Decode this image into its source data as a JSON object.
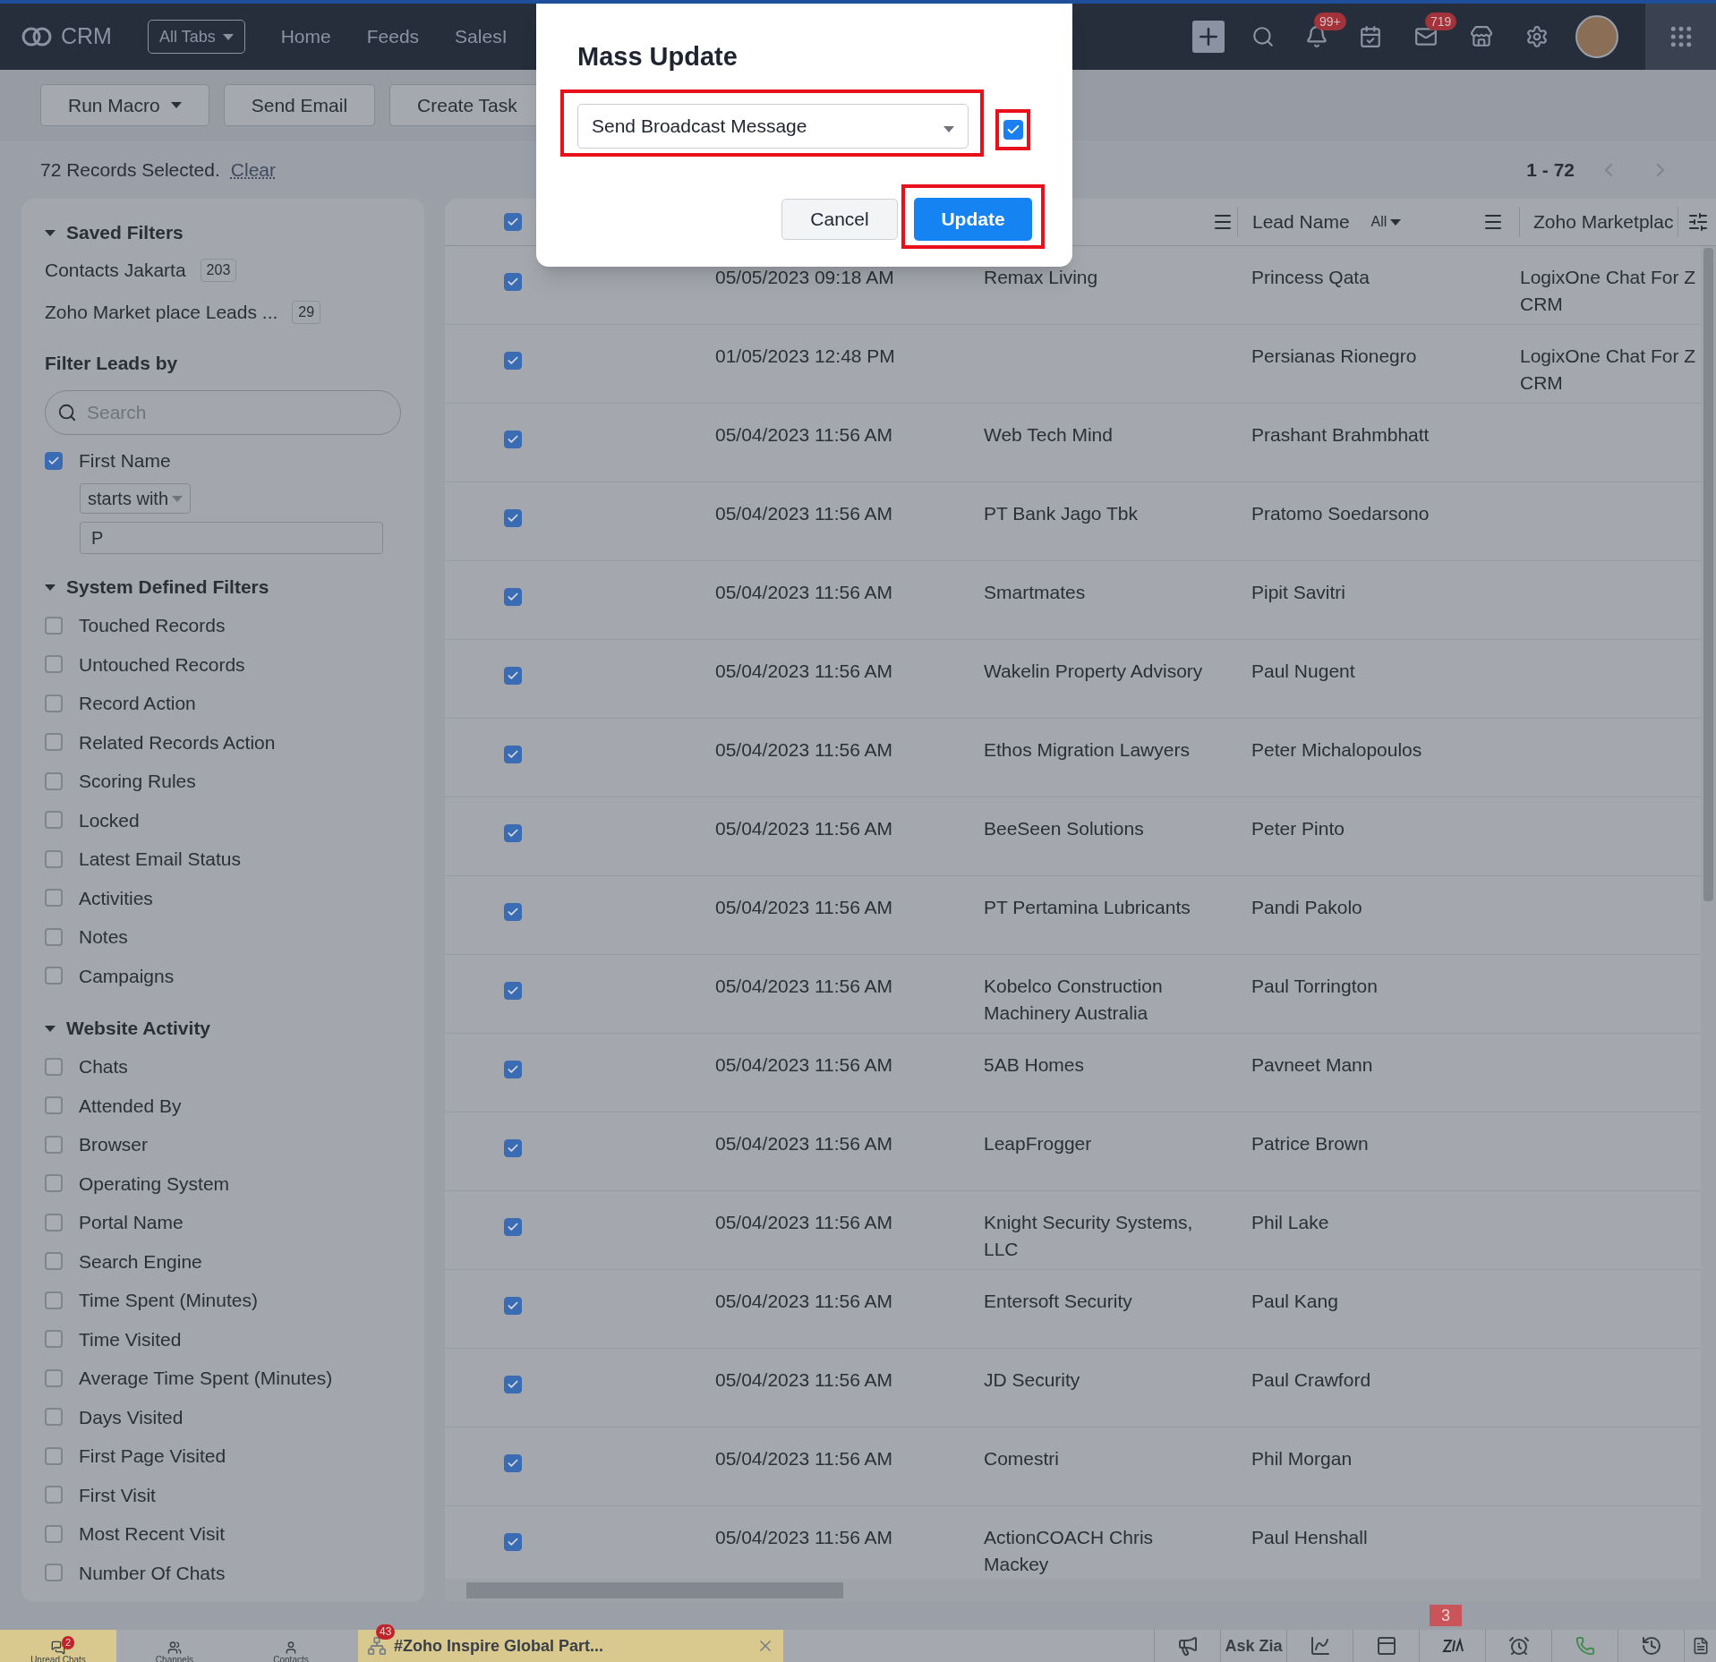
{
  "topbar": {
    "brand": "CRM",
    "all_tabs": "All Tabs",
    "nav": [
      "Home",
      "Feeds",
      "SalesI"
    ],
    "notifications_badge": "99+",
    "mail_badge": "719"
  },
  "toolbar": {
    "buttons": [
      {
        "label": "Run Macro",
        "dropdown": true
      },
      {
        "label": "Send Email",
        "dropdown": false
      },
      {
        "label": "Create Task",
        "dropdown": false
      }
    ]
  },
  "selection": {
    "count": "72",
    "text": "Records Selected.",
    "clear": "Clear",
    "range": "1 - 72"
  },
  "sidebar": {
    "saved_filters": {
      "title": "Saved Filters",
      "expanded": true,
      "items": [
        {
          "label": "Contacts Jakarta",
          "count": "203"
        },
        {
          "label": "Zoho Market place Leads ...",
          "count": "29"
        }
      ]
    },
    "filter_by": {
      "title": "Filter Leads by",
      "search_placeholder": "Search",
      "field": {
        "label": "First Name",
        "checked": true,
        "operator": "starts with",
        "value": "P"
      }
    },
    "groups": [
      {
        "title": "System Defined Filters",
        "expanded": true,
        "items": [
          {
            "label": "Touched Records",
            "checked": false
          },
          {
            "label": "Untouched Records",
            "checked": false
          },
          {
            "label": "Record Action",
            "checked": false
          },
          {
            "label": "Related Records Action",
            "checked": false
          },
          {
            "label": "Scoring Rules",
            "checked": false
          },
          {
            "label": "Locked",
            "checked": false
          },
          {
            "label": "Latest Email Status",
            "checked": false
          },
          {
            "label": "Activities",
            "checked": false
          },
          {
            "label": "Notes",
            "checked": false
          },
          {
            "label": "Campaigns",
            "checked": false
          }
        ]
      },
      {
        "title": "Website Activity",
        "expanded": true,
        "items": [
          {
            "label": "Chats",
            "checked": false
          },
          {
            "label": "Attended By",
            "checked": false
          },
          {
            "label": "Browser",
            "checked": false
          },
          {
            "label": "Operating System",
            "checked": false
          },
          {
            "label": "Portal Name",
            "checked": false
          },
          {
            "label": "Search Engine",
            "checked": false
          },
          {
            "label": "Time Spent (Minutes)",
            "checked": false
          },
          {
            "label": "Time Visited",
            "checked": false
          },
          {
            "label": "Average Time Spent (Minutes)",
            "checked": false
          },
          {
            "label": "Days Visited",
            "checked": false
          },
          {
            "label": "First Page Visited",
            "checked": false
          },
          {
            "label": "First Visit",
            "checked": false
          },
          {
            "label": "Most Recent Visit",
            "checked": false
          },
          {
            "label": "Number Of Chats",
            "checked": false
          }
        ]
      }
    ]
  },
  "table": {
    "header_checked": true,
    "columns": [
      {
        "label": "Lead Name",
        "filter": "All"
      },
      {
        "label": "Zoho Marketplac"
      }
    ],
    "rows": [
      {
        "checked": true,
        "date": "05/05/2023 09:18 AM",
        "company": [
          "Remax Living"
        ],
        "lead_name": "Princess Qata",
        "marketplace": [
          "LogixOne Chat For Z",
          "CRM"
        ]
      },
      {
        "checked": true,
        "date": "01/05/2023 12:48 PM",
        "lead_name": "Persianas Rionegro",
        "marketplace": [
          "LogixOne Chat For Z",
          "CRM"
        ]
      },
      {
        "checked": true,
        "date": "05/04/2023 11:56 AM",
        "company": [
          "Web Tech Mind"
        ],
        "lead_name": "Prashant Brahmbhatt"
      },
      {
        "checked": true,
        "date": "05/04/2023 11:56 AM",
        "company": [
          "PT Bank Jago Tbk"
        ],
        "lead_name": "Pratomo Soedarsono"
      },
      {
        "checked": true,
        "date": "05/04/2023 11:56 AM",
        "company": [
          "Smartmates"
        ],
        "lead_name": "Pipit Savitri"
      },
      {
        "checked": true,
        "date": "05/04/2023 11:56 AM",
        "company": [
          "Wakelin Property Advisory"
        ],
        "lead_name": "Paul Nugent"
      },
      {
        "checked": true,
        "date": "05/04/2023 11:56 AM",
        "company": [
          "Ethos Migration Lawyers"
        ],
        "lead_name": "Peter Michalopoulos"
      },
      {
        "checked": true,
        "date": "05/04/2023 11:56 AM",
        "company": [
          "BeeSeen Solutions"
        ],
        "lead_name": "Peter Pinto"
      },
      {
        "checked": true,
        "date": "05/04/2023 11:56 AM",
        "company": [
          "PT Pertamina Lubricants"
        ],
        "lead_name": "Pandi Pakolo"
      },
      {
        "checked": true,
        "date": "05/04/2023 11:56 AM",
        "company": [
          "Kobelco Construction",
          "Machinery Australia"
        ],
        "lead_name": "Paul Torrington"
      },
      {
        "checked": true,
        "date": "05/04/2023 11:56 AM",
        "company": [
          "5AB Homes"
        ],
        "lead_name": "Pavneet Mann"
      },
      {
        "checked": true,
        "date": "05/04/2023 11:56 AM",
        "company": [
          "LeapFrogger"
        ],
        "lead_name": "Patrice Brown"
      },
      {
        "checked": true,
        "date": "05/04/2023 11:56 AM",
        "company": [
          "Knight Security Systems,",
          "LLC"
        ],
        "lead_name": "Phil Lake"
      },
      {
        "checked": true,
        "date": "05/04/2023 11:56 AM",
        "company": [
          "Entersoft Security"
        ],
        "lead_name": "Paul Kang"
      },
      {
        "checked": true,
        "date": "05/04/2023 11:56 AM",
        "company": [
          "JD Security"
        ],
        "lead_name": "Paul Crawford"
      },
      {
        "checked": true,
        "date": "05/04/2023 11:56 AM",
        "company": [
          "Comestri"
        ],
        "lead_name": "Phil Morgan"
      },
      {
        "checked": true,
        "date": "05/04/2023 11:56 AM",
        "company": [
          "ActionCOACH Chris",
          "Mackey"
        ],
        "lead_name": "Paul Henshall"
      }
    ]
  },
  "modal": {
    "title": "Mass Update",
    "select": "Send Broadcast Message",
    "checked": true,
    "cancel": "Cancel",
    "update": "Update"
  },
  "bottom_bar": {
    "tabs": [
      {
        "label": "Unread Chats",
        "kind": "chats",
        "badge": "2",
        "selected": true
      },
      {
        "label": "Channels",
        "kind": "channels",
        "selected": false
      },
      {
        "label": "Contacts",
        "kind": "contacts",
        "selected": false
      }
    ],
    "chat_tab": {
      "label": "#Zoho Inspire Global Part...",
      "badge": "43"
    },
    "ask_zia": "Ask Zia",
    "zia_badge": "3"
  }
}
